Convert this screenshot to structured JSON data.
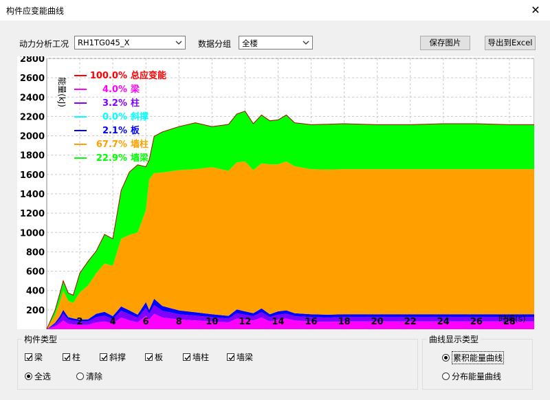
{
  "window": {
    "title": "构件应变能曲线",
    "close_glyph": "✕"
  },
  "controls": {
    "analysis_case_label": "动力分析工况",
    "analysis_case_value": "RH1TG045_X",
    "data_group_label": "数据分组",
    "data_group_value": "全楼",
    "save_image_label": "保存图片",
    "export_excel_label": "导出到Excel"
  },
  "chart_data": {
    "type": "area",
    "stacked": true,
    "ylabel": "能量(kJ)",
    "xlabel": "时间(s)",
    "ylim": [
      0,
      2800
    ],
    "xlim": [
      0,
      29.5
    ],
    "grid": true,
    "y_ticks": [
      "200",
      "400",
      "600",
      "800",
      "1000",
      "1200",
      "1400",
      "1600",
      "1800",
      "2000",
      "2200",
      "2400",
      "2600",
      "2800"
    ],
    "x_ticks": [
      "2",
      "4",
      "6",
      "8",
      "10",
      "12",
      "14",
      "16",
      "18",
      "20",
      "22",
      "24",
      "26",
      "28"
    ],
    "legend": [
      {
        "pct": "100.0%",
        "name": "总应变能",
        "color": "#ff0000"
      },
      {
        "pct": "4.0%",
        "name": "梁",
        "color": "#ff00ff"
      },
      {
        "pct": "3.2%",
        "name": "柱",
        "color": "#8000ff"
      },
      {
        "pct": "0.0%",
        "name": "斜撑",
        "color": "#00ffff"
      },
      {
        "pct": "2.1%",
        "name": "板",
        "color": "#0000ff"
      },
      {
        "pct": "67.7%",
        "name": "墙柱",
        "color": "#ffa000"
      },
      {
        "pct": "22.9%",
        "name": "墙梁",
        "color": "#00ff00"
      }
    ],
    "x": [
      0,
      0.5,
      0.8,
      1,
      1.3,
      1.6,
      2,
      2.5,
      3,
      3.5,
      4,
      4.5,
      5,
      5.5,
      6,
      6.2,
      6.5,
      7,
      8,
      9,
      10,
      11,
      11.5,
      12,
      12.5,
      13,
      13.5,
      14,
      14.5,
      15,
      16,
      17,
      18,
      20,
      22,
      24,
      26,
      28,
      29.5
    ],
    "series": [
      {
        "name": "梁",
        "values": [
          0,
          30,
          60,
          90,
          55,
          50,
          45,
          45,
          70,
          80,
          60,
          120,
          90,
          70,
          140,
          100,
          160,
          120,
          100,
          90,
          80,
          70,
          110,
          100,
          90,
          120,
          80,
          100,
          110,
          90,
          80,
          75,
          80,
          80,
          80,
          80,
          80,
          80,
          80
        ]
      },
      {
        "name": "柱",
        "values": [
          0,
          20,
          45,
          70,
          45,
          40,
          35,
          35,
          55,
          60,
          45,
          70,
          65,
          50,
          80,
          60,
          90,
          70,
          55,
          50,
          45,
          40,
          55,
          50,
          45,
          55,
          45,
          50,
          50,
          45,
          45,
          45,
          45,
          45,
          45,
          45,
          45,
          45,
          45
        ]
      },
      {
        "name": "斜撑",
        "values": [
          0,
          0,
          0,
          0,
          0,
          0,
          0,
          0,
          0,
          0,
          0,
          0,
          0,
          0,
          0,
          0,
          0,
          0,
          0,
          0,
          0,
          0,
          0,
          0,
          0,
          0,
          0,
          0,
          0,
          0,
          0,
          0,
          0,
          0,
          0,
          0,
          0,
          0,
          0
        ]
      },
      {
        "name": "板",
        "values": [
          0,
          15,
          30,
          40,
          25,
          22,
          20,
          22,
          35,
          40,
          30,
          45,
          40,
          30,
          60,
          40,
          65,
          50,
          40,
          35,
          30,
          28,
          40,
          35,
          30,
          40,
          30,
          35,
          35,
          30,
          30,
          30,
          30,
          30,
          30,
          30,
          30,
          30,
          30
        ]
      },
      {
        "name": "墙柱",
        "values": [
          0,
          80,
          150,
          200,
          170,
          160,
          280,
          350,
          420,
          500,
          520,
          700,
          780,
          850,
          950,
          1350,
          1300,
          1380,
          1450,
          1480,
          1520,
          1500,
          1520,
          1550,
          1480,
          1500,
          1550,
          1520,
          1540,
          1520,
          1500,
          1500,
          1500,
          1500,
          1500,
          1500,
          1500,
          1500,
          1500
        ]
      },
      {
        "name": "墙梁",
        "values": [
          0,
          50,
          90,
          100,
          80,
          80,
          200,
          250,
          230,
          300,
          280,
          500,
          650,
          700,
          450,
          200,
          380,
          420,
          450,
          480,
          420,
          480,
          500,
          520,
          480,
          500,
          450,
          460,
          480,
          450,
          460,
          470,
          470,
          460,
          460,
          470,
          470,
          460,
          460
        ]
      }
    ]
  },
  "component_types": {
    "title": "构件类型",
    "items": [
      {
        "label": "梁",
        "checked": true
      },
      {
        "label": "柱",
        "checked": true
      },
      {
        "label": "斜撑",
        "checked": true
      },
      {
        "label": "板",
        "checked": true
      },
      {
        "label": "墙柱",
        "checked": true
      },
      {
        "label": "墙梁",
        "checked": true
      }
    ],
    "select_all_label": "全选",
    "clear_label": "清除"
  },
  "curve_display": {
    "title": "曲线显示类型",
    "cumulative_label": "累积能量曲线",
    "distribution_label": "分布能量曲线",
    "selected": "cumulative"
  }
}
